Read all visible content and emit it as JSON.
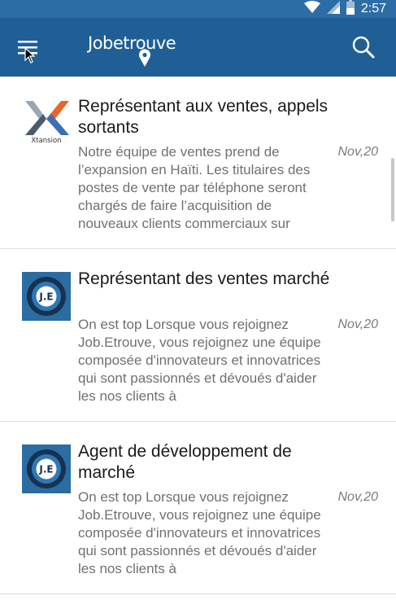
{
  "status_bar": {
    "time": "2:57",
    "icons": [
      "wifi-icon",
      "signal-icon",
      "battery-icon"
    ]
  },
  "app_bar": {
    "logo_text": "Jobetrouve",
    "menu_icon": "hamburger-menu-icon",
    "search_icon": "search-icon",
    "background": "#1f5f95",
    "status_background": "#2d6da5"
  },
  "jobs": [
    {
      "title": "Représentant aux ventes, appels sortants",
      "description": "Notre équipe de ventes prend de l’expansion en Haïti. Les titulaires des postes de vente par téléphone seront chargés de faire l’acquisition de nouveaux clients commerciaux sur",
      "date": "Nov,20",
      "logo": "xtansion-logo",
      "logo_text": "Xtansion"
    },
    {
      "title": "Représentant des ventes marché",
      "description": "On est top Lorsque vous rejoignez Job.Etrouve, vous rejoignez une équipe composée d'innovateurs et innovatrices qui sont passionnés et dévoués d'aider les nos clients à",
      "date": "Nov,20",
      "logo": "jobetrouve-logo",
      "logo_text": "J.E"
    },
    {
      "title": "Agent de développement de marché",
      "description": "On est top Lorsque vous rejoignez Job.Etrouve, vous rejoignez une équipe composée d'innovateurs et innovatrices qui sont passionnés et dévoués d'aider les nos clients à",
      "date": "Nov,20",
      "logo": "jobetrouve-logo",
      "logo_text": "J.E"
    }
  ]
}
